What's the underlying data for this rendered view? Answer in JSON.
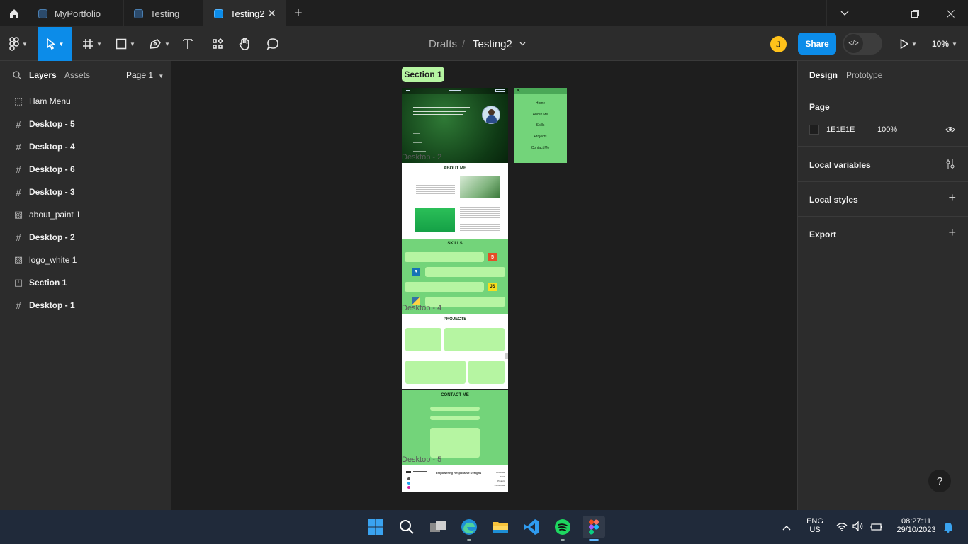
{
  "tabs": [
    {
      "label": "MyPortfolio",
      "active": false
    },
    {
      "label": "Testing",
      "active": false
    },
    {
      "label": "Testing2",
      "active": true
    }
  ],
  "toolbar": {
    "breadcrumb_parent": "Drafts",
    "breadcrumb_sep": "/",
    "file_name": "Testing2",
    "avatar_initial": "J",
    "share_label": "Share",
    "zoom": "10%"
  },
  "left_panel": {
    "tab_layers": "Layers",
    "tab_assets": "Assets",
    "page_selector": "Page 1",
    "layers": [
      {
        "name": "Ham Menu",
        "icon": "dashed-frame-icon"
      },
      {
        "name": "Desktop - 5",
        "icon": "frame-hash-icon"
      },
      {
        "name": "Desktop - 4",
        "icon": "frame-hash-icon"
      },
      {
        "name": "Desktop - 6",
        "icon": "frame-hash-icon"
      },
      {
        "name": "Desktop - 3",
        "icon": "frame-hash-icon"
      },
      {
        "name": "about_paint 1",
        "icon": "image-icon"
      },
      {
        "name": "Desktop - 2",
        "icon": "frame-hash-icon"
      },
      {
        "name": "logo_white 1",
        "icon": "image-icon"
      },
      {
        "name": "Section 1",
        "icon": "section-icon"
      },
      {
        "name": "Desktop - 1",
        "icon": "frame-hash-icon"
      }
    ]
  },
  "right_panel": {
    "tab_design": "Design",
    "tab_prototype": "Prototype",
    "page_heading": "Page",
    "page_color": "1E1E1E",
    "page_opacity": "100%",
    "local_variables": "Local variables",
    "local_styles": "Local styles",
    "export": "Export"
  },
  "canvas": {
    "section_label": "Section 1",
    "frame_labels": [
      "Desktop - 2",
      "Desktop - 4",
      "Desktop - 5"
    ],
    "about_heading": "ABOUT ME",
    "skills_heading": "SKILLS",
    "projects_heading": "PROJECTS",
    "contact_heading": "CONTACT ME",
    "ham_menu_items": [
      "Home",
      "About Me",
      "Skills",
      "Projects",
      "Contact Me"
    ],
    "footer_tagline": "Empowering Responsive Designs",
    "footer_links": [
      "About Me",
      "Skills",
      "Projects",
      "Contact Me"
    ],
    "skill_badges": [
      "5",
      "3",
      "JS"
    ]
  },
  "taskbar": {
    "lang_top": "ENG",
    "lang_bottom": "US",
    "time": "08:27:11",
    "date": "29/10/2023"
  },
  "help_label": "?"
}
